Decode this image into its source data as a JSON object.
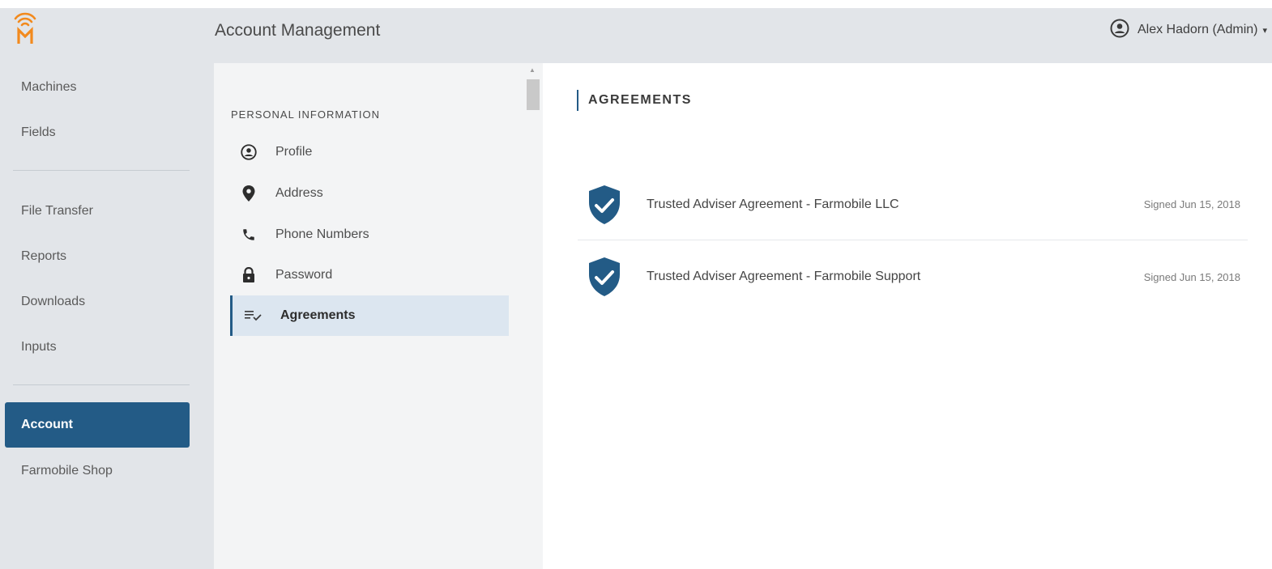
{
  "header": {
    "title": "Account Management",
    "user_name": "Alex Hadorn (Admin)",
    "logo_icon": "farmobile-logo-icon",
    "user_icon": "user-circle-icon",
    "caret": "▾"
  },
  "sidebar": {
    "items": [
      {
        "label": "Machines"
      },
      {
        "label": "Fields"
      },
      {
        "label": "File Transfer"
      },
      {
        "label": "Reports"
      },
      {
        "label": "Downloads"
      },
      {
        "label": "Inputs"
      },
      {
        "label": "Account",
        "active": true
      },
      {
        "label": "Farmobile Shop"
      }
    ]
  },
  "settings": {
    "section_title": "PERSONAL INFORMATION",
    "items": [
      {
        "label": "Profile",
        "icon": "profile-icon"
      },
      {
        "label": "Address",
        "icon": "location-pin-icon"
      },
      {
        "label": "Phone Numbers",
        "icon": "phone-icon"
      },
      {
        "label": "Password",
        "icon": "lock-icon"
      },
      {
        "label": "Agreements",
        "icon": "agreements-icon",
        "active": true
      }
    ]
  },
  "content": {
    "title": "AGREEMENTS",
    "agreements": [
      {
        "name": "Trusted Adviser Agreement - Farmobile LLC",
        "status": "Signed Jun 15, 2018",
        "icon": "shield-check-icon"
      },
      {
        "name": "Trusted Adviser Agreement - Farmobile Support",
        "status": "Signed Jun 15, 2018",
        "icon": "shield-check-icon"
      }
    ]
  },
  "colors": {
    "accent": "#235b86",
    "logo": "#f28a1e",
    "nav_background": "#e2e5e9",
    "active_item_background": "#dce6f0"
  }
}
